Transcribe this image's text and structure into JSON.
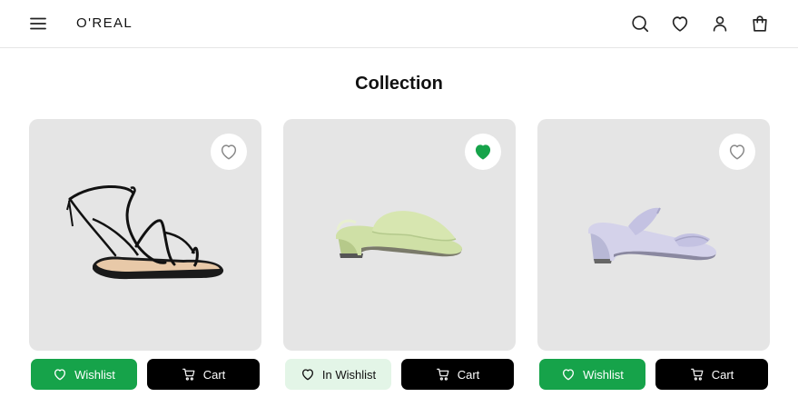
{
  "brand": "O'REAL",
  "page_title": "Collection",
  "colors": {
    "accent": "#16a34a",
    "accent_light": "#e3f5e7",
    "card_bg": "#e5e5e5",
    "dark": "#000000"
  },
  "nav_icons": [
    "search-icon",
    "heart-icon",
    "user-icon",
    "bag-icon"
  ],
  "products": [
    {
      "favorited": false,
      "wishlist_label": "Wishlist",
      "cart_label": "Cart",
      "shoe": "black lace-up sandal"
    },
    {
      "favorited": true,
      "wishlist_label": "In Wishlist",
      "cart_label": "Cart",
      "shoe": "green block-heel mule"
    },
    {
      "favorited": false,
      "wishlist_label": "Wishlist",
      "cart_label": "Cart",
      "shoe": "lavender two-strap heel"
    }
  ]
}
